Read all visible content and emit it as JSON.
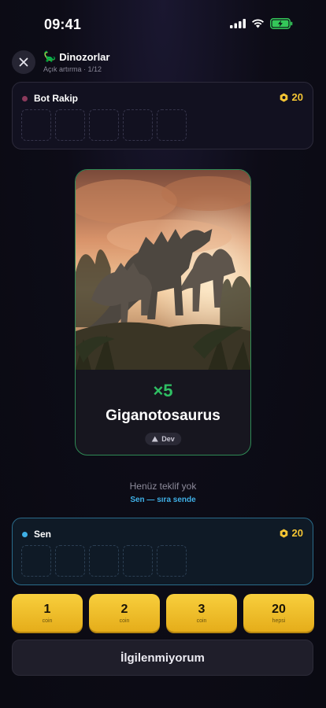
{
  "status_bar": {
    "time": "09:41"
  },
  "header": {
    "emoji": "🦕",
    "title": "Dinozorlar",
    "subtitle": "Açık artırma · 1/12"
  },
  "opponent": {
    "name": "Bot Rakip",
    "coins": "20",
    "dot_color": "#8b3a5c"
  },
  "card": {
    "multiplier": "×5",
    "name": "Giganotosaurus",
    "badge": "Dev",
    "border_color": "#2f8a55"
  },
  "status": {
    "no_bid": "Henüz teklif yok",
    "turn": "Sen — sıra sende"
  },
  "player": {
    "name": "Sen",
    "coins": "20",
    "dot_color": "#3fb0e6"
  },
  "bids": [
    {
      "amount": "1",
      "unit": "coin"
    },
    {
      "amount": "2",
      "unit": "coin"
    },
    {
      "amount": "3",
      "unit": "coin"
    },
    {
      "amount": "20",
      "unit": "hepsi"
    }
  ],
  "pass_button": "İlgilenmiyorum",
  "colors": {
    "accent_gold": "#f4c534",
    "accent_green": "#2fbf63",
    "accent_blue": "#3fb0e6"
  }
}
